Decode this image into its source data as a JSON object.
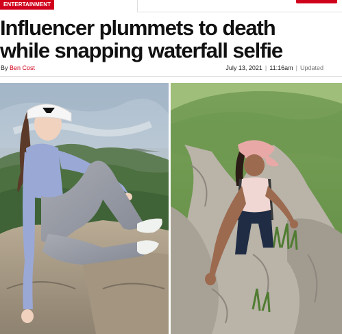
{
  "category": "ENTERTAINMENT",
  "headline": {
    "line1": "Influencer plummets to death",
    "line2": "while snapping waterfall selfie"
  },
  "byline": {
    "prefix": "By",
    "author": "Ben Cost"
  },
  "dateline": {
    "date": "July 13, 2021",
    "time": "11:16am",
    "status": "Updated"
  },
  "colors": {
    "accent": "#d0021b",
    "headline": "#111111",
    "muted": "#777777"
  },
  "photos": [
    {
      "subject": "woman in white visor sitting on rocky summit overlooking green hills and sea"
    },
    {
      "subject": "woman in pink cap climbing steep rocky trail on grassy hillside"
    }
  ]
}
